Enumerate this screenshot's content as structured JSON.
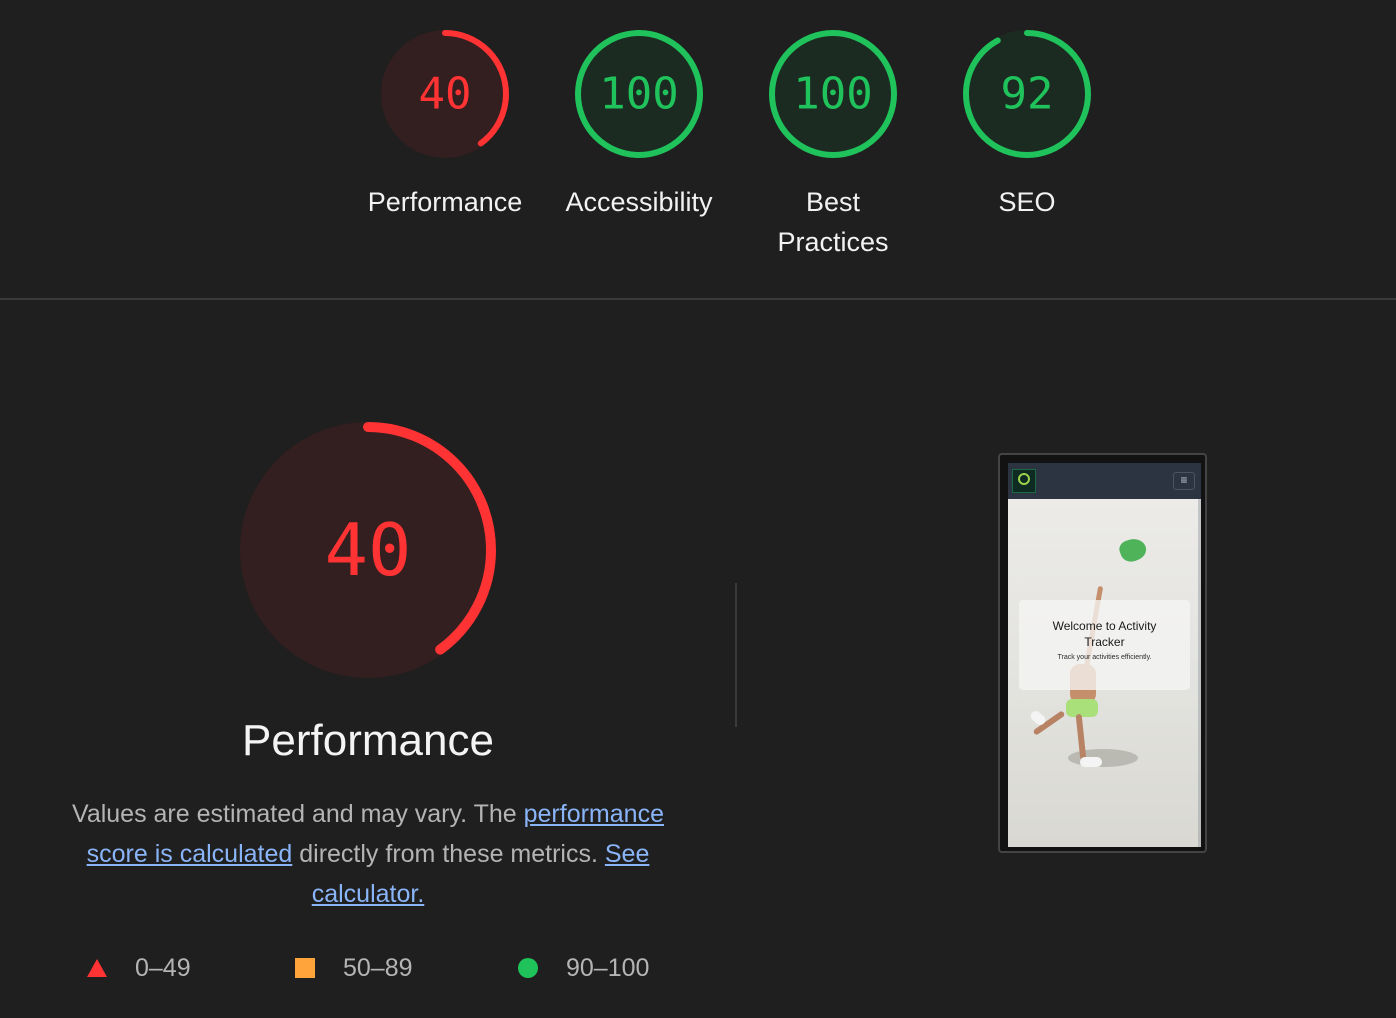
{
  "categories": [
    {
      "id": "performance",
      "label": "Performance",
      "score": 40,
      "status": "fail"
    },
    {
      "id": "accessibility",
      "label": "Accessibility",
      "score": 100,
      "status": "pass"
    },
    {
      "id": "best-practices",
      "label": "Best Practices",
      "score": 100,
      "status": "pass"
    },
    {
      "id": "seo",
      "label": "SEO",
      "score": 92,
      "status": "pass"
    }
  ],
  "performance_section": {
    "score": 40,
    "title": "Performance",
    "desc_text_1": "Values are estimated and may vary. The ",
    "link_1": "performance score is calculated",
    "desc_text_2": " directly from these metrics. ",
    "link_2": "See calculator."
  },
  "legend": [
    {
      "shape": "triangle",
      "range": "0–49"
    },
    {
      "shape": "square",
      "range": "50–89"
    },
    {
      "shape": "circle",
      "range": "90–100"
    }
  ],
  "screenshot": {
    "hero_title": "Welcome to Activity Tracker",
    "hero_subtitle": "Track your activities efficiently.",
    "menu_icon": "≡"
  },
  "colors": {
    "fail": "#ff3333",
    "fail_bg": "#331f1f",
    "average": "#ffa33b",
    "pass": "#1fc25b",
    "pass_bg": "#1c2b22",
    "link": "#8ab4f8"
  }
}
